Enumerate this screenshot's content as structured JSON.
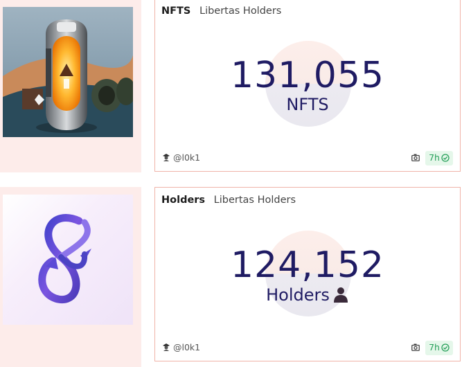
{
  "cards": [
    {
      "title": "NFTS",
      "subtitle": "Libertas Holders",
      "value": "131,055",
      "unit": "NFTS",
      "username": "@l0k1",
      "age": "7h",
      "thumbnail_icon": "capsule-lamp-image",
      "icons": {
        "user": "user-hat-icon",
        "camera": "camera-icon",
        "check": "check-circle-icon"
      }
    },
    {
      "title": "Holders",
      "subtitle": "Libertas Holders",
      "value": "124,152",
      "unit": "Holders",
      "username": "@l0k1",
      "age": "7h",
      "thumbnail_icon": "infinity-loop-image",
      "icons": {
        "user": "user-hat-icon",
        "camera": "camera-icon",
        "check": "check-circle-icon",
        "unit": "person-silhouette-icon"
      }
    }
  ],
  "colors": {
    "accent": "#1f1b63",
    "card_border": "#f0b3a8",
    "thumb_bg": "#fdecea",
    "badge_bg": "#e5f7ea",
    "badge_text": "#27a05a"
  }
}
